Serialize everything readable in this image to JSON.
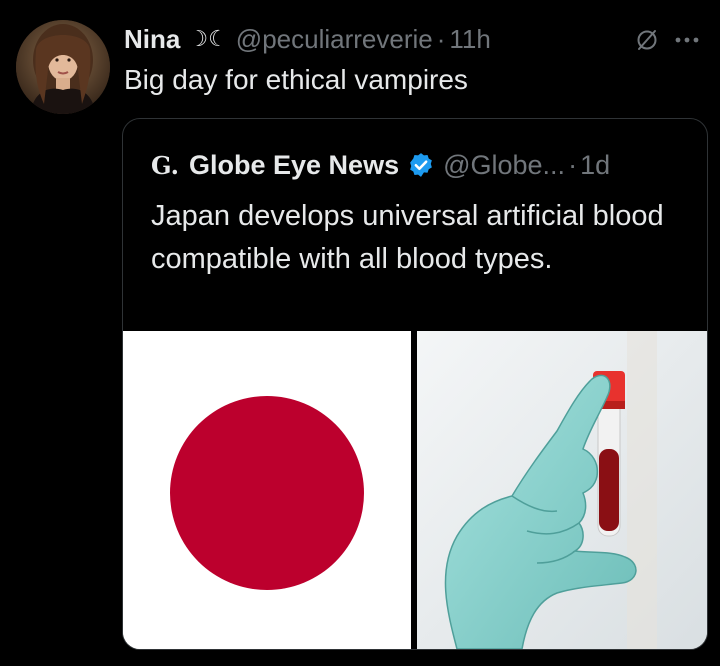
{
  "tweet": {
    "display_name": "Nina",
    "name_emoji": "☽☾",
    "handle": "@peculiarreverie",
    "separator": "·",
    "time": "11h",
    "text": "Big day for ethical vampires",
    "avatar_icon": "user-avatar-photo",
    "grok_icon": "grok-slash-circle-icon",
    "more_icon": "more-horizontal-icon"
  },
  "quoted": {
    "logo": "G.",
    "display_name": "Globe Eye News",
    "verified_icon": "verified-badge-icon",
    "handle": "@Globe...",
    "separator": "·",
    "time": "1d",
    "text": "Japan develops universal artificial blood compatible with all blood types.",
    "images": [
      {
        "icon": "japan-flag-image"
      },
      {
        "icon": "gloved-hand-blood-vial-image"
      }
    ]
  },
  "colors": {
    "background": "#000000",
    "primary_text": "#e7e9ea",
    "secondary_text": "#71767b",
    "border": "#2f3336",
    "verified_blue": "#1d9bf0",
    "flag_red": "#bc002d",
    "glove": "#8fd3cf",
    "vial_cap": "#e8322e",
    "blood": "#8a0f14"
  }
}
